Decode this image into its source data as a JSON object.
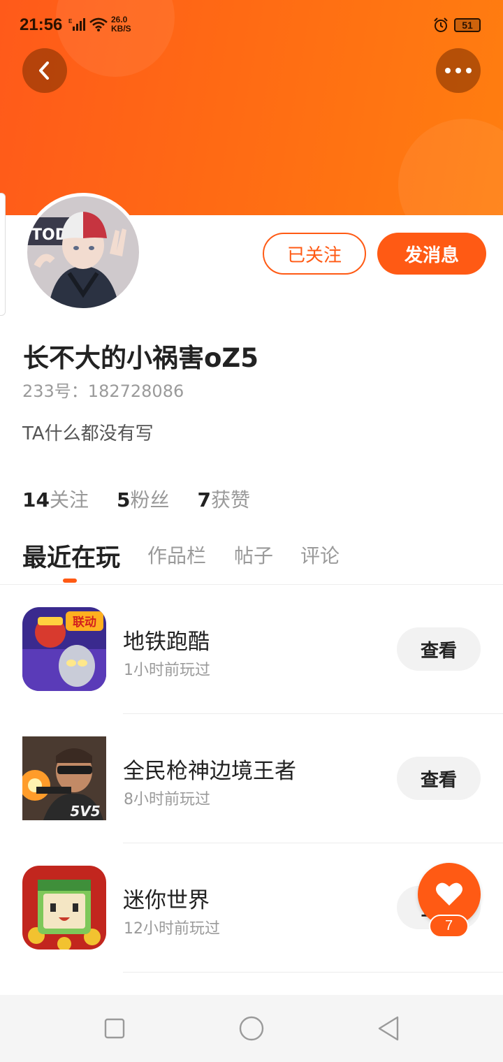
{
  "status_bar": {
    "time": "21:56",
    "network_speed_value": "26.0",
    "network_speed_unit": "KB/S",
    "battery": "51"
  },
  "colors": {
    "accent": "#ff5a14",
    "banner_start": "#ff5a1a",
    "banner_end": "#ff7e10",
    "text_primary": "#222222",
    "text_secondary": "#9a9a9a"
  },
  "header": {
    "back_icon": "chevron-left-icon",
    "more_icon": "more-dots-icon"
  },
  "profile": {
    "follow_label": "已关注",
    "message_label": "发消息",
    "username": "长不大的小祸害oZ5",
    "id_text": "233号：182728086",
    "bio": "TA什么都没有写",
    "stats": [
      {
        "value": "14",
        "label": "关注"
      },
      {
        "value": "5",
        "label": "粉丝"
      },
      {
        "value": "7",
        "label": "获赞"
      }
    ]
  },
  "tabs": [
    {
      "label": "最近在玩",
      "active": true
    },
    {
      "label": "作品栏",
      "active": false
    },
    {
      "label": "帖子",
      "active": false
    },
    {
      "label": "评论",
      "active": false
    }
  ],
  "games": [
    {
      "name": "地铁跑酷",
      "played": "1小时前玩过",
      "button": "查看",
      "icon_badge": "联动"
    },
    {
      "name": "全民枪神边境王者",
      "played": "8小时前玩过",
      "button": "查看",
      "icon_badge": "5V5"
    },
    {
      "name": "迷你世界",
      "played": "12小时前玩过",
      "button": "查看",
      "icon_badge": ""
    }
  ],
  "like_fab": {
    "icon": "heart-icon",
    "count": "7"
  },
  "nav_bar": {
    "icons": [
      "recents-square-icon",
      "home-circle-icon",
      "back-triangle-icon"
    ]
  }
}
